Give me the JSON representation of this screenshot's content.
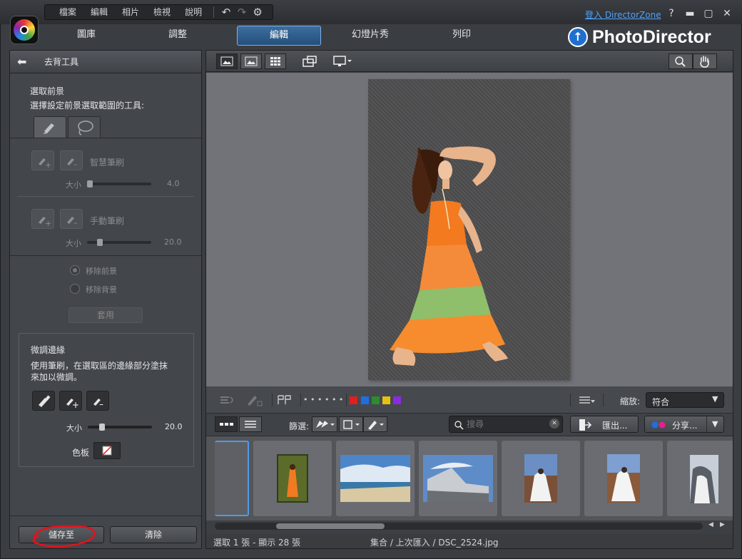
{
  "menu": {
    "file": "檔案",
    "edit": "編輯",
    "photo": "相片",
    "view": "檢視",
    "help": "說明"
  },
  "account": {
    "login_link": "登入 DirectorZone"
  },
  "modes": {
    "library": "圖庫",
    "adjust": "調整",
    "edit": "編輯",
    "slideshow": "幻燈片秀",
    "print": "列印"
  },
  "brand": {
    "name": "PhotoDirector"
  },
  "panel": {
    "title": "去背工具",
    "select_fg_heading": "選取前景",
    "select_fg_desc": "選擇設定前景選取範圍的工具:",
    "smart_brush_label": "智慧筆刷",
    "size_label": "大小",
    "smart_brush_size": "4.0",
    "manual_brush_label": "手動筆刷",
    "manual_brush_size": "20.0",
    "remove_fg": "移除前景",
    "remove_bg": "移除背景",
    "apply": "套用",
    "refine_heading": "微調邊緣",
    "refine_desc_1": "使用筆刷，在選取區的邊緣部分塗抹",
    "refine_desc_2": "來加以微調。",
    "refine_size": "20.0",
    "palette_label": "色板",
    "save_to": "儲存至",
    "clear": "清除"
  },
  "toolstrip": {
    "zoom_label": "縮放:",
    "zoom_value": "符合",
    "dots": "• • • • • •"
  },
  "color_labels": [
    "#e02020",
    "#1f6fe0",
    "#2e8b2e",
    "#e8c010",
    "#8a2be2"
  ],
  "filterbar": {
    "filter_label": "篩選:",
    "search_placeholder": "搜尋",
    "export": "匯出...",
    "share": "分享..."
  },
  "status": {
    "selection": "選取 1 張 - 顯示 28 張",
    "path": "集合 / 上次匯入 / DSC_2524.jpg"
  }
}
